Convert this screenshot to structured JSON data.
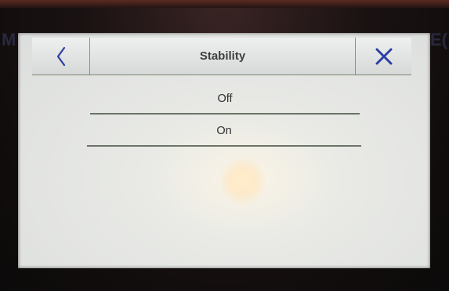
{
  "header": {
    "title": "Stability",
    "back_icon": "chevron-left-icon",
    "close_icon": "close-icon"
  },
  "options": [
    {
      "label": "Off"
    },
    {
      "label": "On"
    }
  ],
  "colors": {
    "icon": "#2d3fa3",
    "divider": "#6b7467"
  }
}
